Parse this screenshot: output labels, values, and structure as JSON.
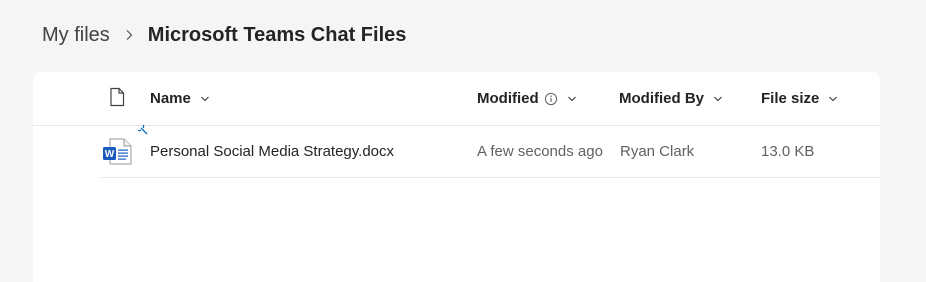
{
  "breadcrumb": {
    "root": "My files",
    "current": "Microsoft Teams Chat Files"
  },
  "columns": {
    "type_icon": "document-icon",
    "name": "Name",
    "modified": "Modified",
    "modified_by": "Modified By",
    "file_size": "File size"
  },
  "files": [
    {
      "icon": "word-document-icon",
      "new_indicator": "new-file-sparkle-icon",
      "name": "Personal Social Media Strategy.docx",
      "modified": "A few seconds ago",
      "modified_by": "Ryan Clark",
      "file_size": "13.0 KB"
    }
  ],
  "colors": {
    "word_blue": "#185abd",
    "background": "#f5f5f5",
    "card": "#ffffff"
  }
}
